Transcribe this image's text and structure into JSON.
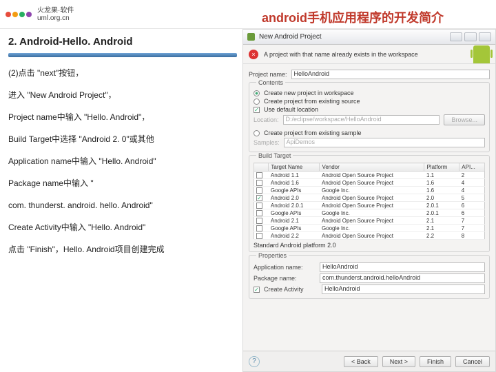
{
  "header": {
    "logo_l1": "火龙果·软件",
    "logo_l2": "uml.org.cn",
    "title": "android手机应用程序的开发简介"
  },
  "left": {
    "section": "2. Android-Hello. Android",
    "p1": "(2)点击 \"next\"按钮，",
    "p2": "进入 \"New Android Project\"，",
    "p3": "Project name中输入 \"Hello. Android\"，",
    "p4": "Build Target中选择 \"Android 2. 0\"或其他",
    "p5": "Application name中输入 \"Hello. Android\"",
    "p6": "Package name中输入 \"",
    "p7": "com. thunderst. android. hello. Android\"",
    "p8": "Create Activity中输入 \"Hello. Android\"",
    "p9": "点击 \"Finish\"，Hello. Android项目创建完成"
  },
  "dlg": {
    "title": "New Android Project",
    "sub": "A project with that name already exists in the workspace",
    "projname_lbl": "Project name:",
    "projname_val": "HelloAndroid",
    "grp_contents": "Contents",
    "r1": "Create new project in workspace",
    "r2": "Create project from existing source",
    "use_def": "Use default location",
    "loc_lbl": "Location:",
    "loc_val": "D:/eclipse/workspace/HelloAndroid",
    "browse": "Browse...",
    "r3": "Create project from existing sample",
    "samples_lbl": "Samples:",
    "samples_val": "ApiDemos",
    "grp_target": "Build Target",
    "th1": "Target Name",
    "th2": "Vendor",
    "th3": "Platform",
    "th4": "API...",
    "rows": [
      {
        "c": "",
        "n": "Android 1.1",
        "v": "Android Open Source Project",
        "p": "1.1",
        "a": "2"
      },
      {
        "c": "",
        "n": "Android 1.6",
        "v": "Android Open Source Project",
        "p": "1.6",
        "a": "4"
      },
      {
        "c": "",
        "n": "Google APIs",
        "v": "Google Inc.",
        "p": "1.6",
        "a": "4"
      },
      {
        "c": "✓",
        "n": "Android 2.0",
        "v": "Android Open Source Project",
        "p": "2.0",
        "a": "5"
      },
      {
        "c": "",
        "n": "Android 2.0.1",
        "v": "Android Open Source Project",
        "p": "2.0.1",
        "a": "6"
      },
      {
        "c": "",
        "n": "Google APIs",
        "v": "Google Inc.",
        "p": "2.0.1",
        "a": "6"
      },
      {
        "c": "",
        "n": "Android 2.1",
        "v": "Android Open Source Project",
        "p": "2.1",
        "a": "7"
      },
      {
        "c": "",
        "n": "Google APIs",
        "v": "Google Inc.",
        "p": "2.1",
        "a": "7"
      },
      {
        "c": "",
        "n": "Android 2.2",
        "v": "Android Open Source Project",
        "p": "2.2",
        "a": "8"
      }
    ],
    "std": "Standard Android platform 2.0",
    "grp_props": "Properties",
    "app_lbl": "Application name:",
    "app_val": "HelloAndroid",
    "pkg_lbl": "Package name:",
    "pkg_val": "com.thunderst.android.helloAndroid",
    "ca_lbl": "Create Activity",
    "ca_val": "HelloAndroid",
    "btn_back": "< Back",
    "btn_next": "Next >",
    "btn_finish": "Finish",
    "btn_cancel": "Cancel"
  }
}
